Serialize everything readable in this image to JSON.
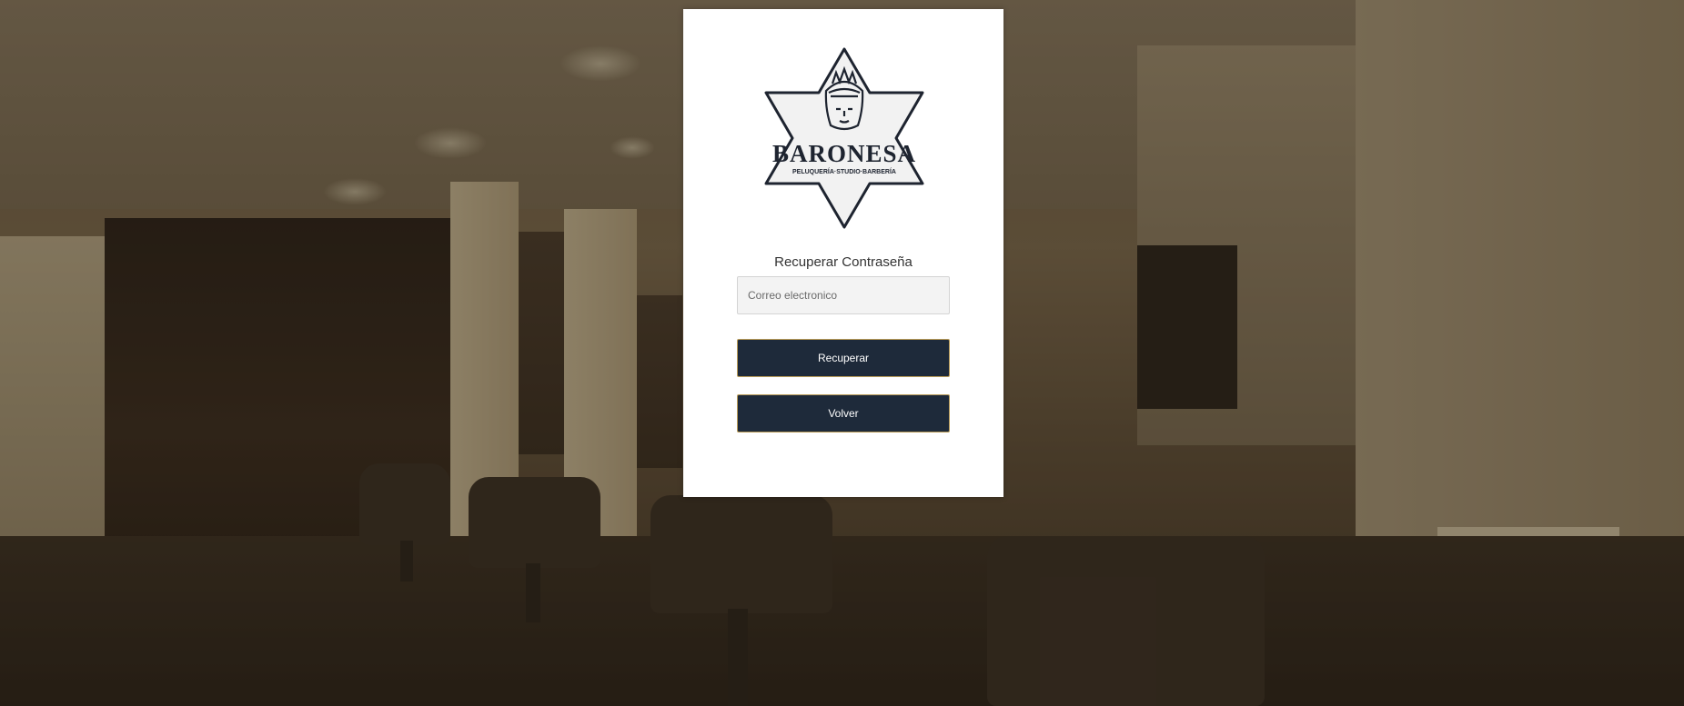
{
  "logo": {
    "brand_name": "BARONESA",
    "tagline": "PELUQUERÍA·STUDIO·BARBERÍA"
  },
  "form": {
    "title": "Recuperar Contraseña",
    "email_placeholder": "Correo electronico",
    "email_value": "",
    "recover_label": "Recuperar",
    "back_label": "Volver"
  },
  "colors": {
    "button_bg": "#1e2a3a",
    "button_border": "#b89a57",
    "card_bg": "#ffffff"
  }
}
